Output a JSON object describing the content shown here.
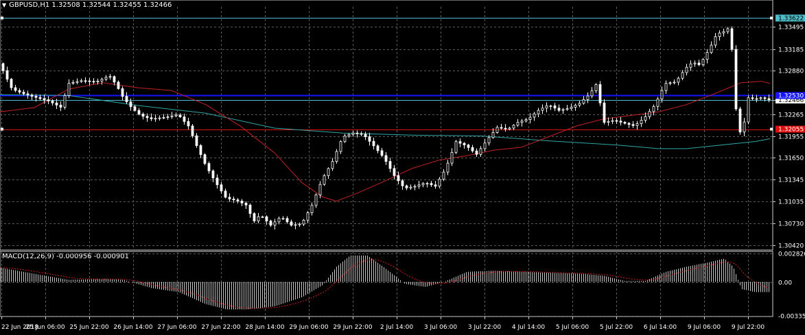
{
  "symbol_title": "GBPUSD,H1  1.32508 1.32544 1.32455 1.32466",
  "macd_title": "MACD(12,26,9) -0.000956 -0.000901",
  "colors": {
    "background": "#000000",
    "grid": "#5a5a5a",
    "candle": "#ffffff",
    "ma_slow": "#2fa7a7",
    "ma_fast": "#c42222",
    "level_high": "#4dbcc8",
    "level_blue": "#1414ff",
    "level_red": "#e01010",
    "macd_hist": "#c8c8c8",
    "macd_signal": "#d42020"
  },
  "price_axis": {
    "ticks": [
      "1.33495",
      "1.33185",
      "1.32880",
      "1.32466",
      "1.32265",
      "1.31955",
      "1.31650",
      "1.31345",
      "1.31035",
      "1.30730",
      "1.30420"
    ],
    "tick_values": [
      1.33495,
      1.33185,
      1.3288,
      1.32466,
      1.32265,
      1.31955,
      1.3165,
      1.31345,
      1.31035,
      1.3073,
      1.3042
    ],
    "range": [
      1.3035,
      1.3378
    ]
  },
  "price_labels": [
    {
      "text": "1.33622",
      "value": 1.33622,
      "bg": "#4dbcc8",
      "fg": "#000000"
    },
    {
      "text": "1.32466",
      "value": 1.32466,
      "bg": "#ffffff",
      "fg": "#000000"
    },
    {
      "text": "1.32055",
      "value": 1.32055,
      "bg": "#e01010",
      "fg": "#ffffff"
    },
    {
      "text": "1.32530",
      "value": 1.3253,
      "bg": "#1414ff",
      "fg": "#ffffff"
    }
  ],
  "levels": [
    {
      "name": "high-level",
      "value": 1.33622,
      "color": "#4dbcc8"
    },
    {
      "name": "blue-level",
      "value": 1.3253,
      "color": "#1414ff"
    },
    {
      "name": "current-level",
      "value": 1.32466,
      "color": "#4dbcc8"
    },
    {
      "name": "red-level",
      "value": 1.32055,
      "color": "#e01010"
    }
  ],
  "macd_axis": {
    "ticks": [
      "0.002826",
      "0.00",
      "-0.003355"
    ],
    "tick_values": [
      0.002826,
      0.0,
      -0.003355
    ]
  },
  "time_axis": [
    "22 Jun 2018",
    "25 Jun 06:00",
    "25 Jun 22:00",
    "26 Jun 14:00",
    "27 Jun 06:00",
    "27 Jun 22:00",
    "28 Jun 14:00",
    "29 Jun 06:00",
    "29 Jun 22:00",
    "2 Jul 14:00",
    "3 Jul 06:00",
    "3 Jul 22:00",
    "4 Jul 14:00",
    "5 Jul 06:00",
    "5 Jul 22:00",
    "6 Jul 14:00",
    "9 Jul 06:00",
    "9 Jul 22:00"
  ],
  "chart_data": {
    "type": "candlestick",
    "title": "GBPUSD,H1",
    "close_path": [
      [
        0,
        1.3298
      ],
      [
        18,
        1.3262
      ],
      [
        36,
        1.3255
      ],
      [
        54,
        1.325
      ],
      [
        72,
        1.3245
      ],
      [
        90,
        1.3236
      ],
      [
        100,
        1.327
      ],
      [
        120,
        1.3274
      ],
      [
        140,
        1.3272
      ],
      [
        160,
        1.3281
      ],
      [
        170,
        1.3268
      ],
      [
        180,
        1.325
      ],
      [
        190,
        1.3238
      ],
      [
        205,
        1.3225
      ],
      [
        220,
        1.322
      ],
      [
        240,
        1.3222
      ],
      [
        260,
        1.3226
      ],
      [
        275,
        1.321
      ],
      [
        288,
        1.318
      ],
      [
        300,
        1.3155
      ],
      [
        315,
        1.313
      ],
      [
        330,
        1.3108
      ],
      [
        345,
        1.3105
      ],
      [
        360,
        1.3098
      ],
      [
        370,
        1.3075
      ],
      [
        380,
        1.3085
      ],
      [
        395,
        1.307
      ],
      [
        410,
        1.3082
      ],
      [
        425,
        1.307
      ],
      [
        440,
        1.3072
      ],
      [
        455,
        1.3098
      ],
      [
        470,
        1.3135
      ],
      [
        485,
        1.316
      ],
      [
        500,
        1.3195
      ],
      [
        515,
        1.32
      ],
      [
        530,
        1.3198
      ],
      [
        545,
        1.3182
      ],
      [
        560,
        1.3165
      ],
      [
        575,
        1.314
      ],
      [
        590,
        1.3122
      ],
      [
        605,
        1.3125
      ],
      [
        620,
        1.313
      ],
      [
        635,
        1.3125
      ],
      [
        650,
        1.315
      ],
      [
        665,
        1.3188
      ],
      [
        680,
        1.3182
      ],
      [
        695,
        1.317
      ],
      [
        710,
        1.319
      ],
      [
        725,
        1.3208
      ],
      [
        740,
        1.3205
      ],
      [
        755,
        1.3215
      ],
      [
        770,
        1.322
      ],
      [
        785,
        1.3232
      ],
      [
        800,
        1.324
      ],
      [
        815,
        1.3232
      ],
      [
        830,
        1.3235
      ],
      [
        845,
        1.3242
      ],
      [
        860,
        1.3255
      ],
      [
        870,
        1.327
      ],
      [
        880,
        1.3215
      ],
      [
        895,
        1.3218
      ],
      [
        910,
        1.3214
      ],
      [
        925,
        1.321
      ],
      [
        940,
        1.3222
      ],
      [
        955,
        1.324
      ],
      [
        970,
        1.327
      ],
      [
        985,
        1.3272
      ],
      [
        1000,
        1.3292
      ],
      [
        1010,
        1.33
      ],
      [
        1020,
        1.3296
      ],
      [
        1035,
        1.332
      ],
      [
        1045,
        1.334
      ],
      [
        1055,
        1.3343
      ],
      [
        1065,
        1.335
      ],
      [
        1070,
        1.327
      ],
      [
        1075,
        1.321
      ],
      [
        1082,
        1.3195
      ],
      [
        1090,
        1.325
      ],
      [
        1100,
        1.3248
      ],
      [
        1110,
        1.325
      ],
      [
        1122,
        1.32466
      ]
    ],
    "ma_slow_path": [
      [
        0,
        1.3254
      ],
      [
        100,
        1.3253
      ],
      [
        200,
        1.3239
      ],
      [
        300,
        1.3228
      ],
      [
        400,
        1.3207
      ],
      [
        500,
        1.32
      ],
      [
        600,
        1.3197
      ],
      [
        700,
        1.3196
      ],
      [
        800,
        1.3189
      ],
      [
        900,
        1.3183
      ],
      [
        960,
        1.3178
      ],
      [
        1000,
        1.3178
      ],
      [
        1060,
        1.3184
      ],
      [
        1100,
        1.3188
      ],
      [
        1122,
        1.3192
      ]
    ],
    "ma_fast_path": [
      [
        0,
        1.323
      ],
      [
        50,
        1.3236
      ],
      [
        100,
        1.3262
      ],
      [
        150,
        1.3271
      ],
      [
        200,
        1.3264
      ],
      [
        250,
        1.326
      ],
      [
        300,
        1.324
      ],
      [
        350,
        1.321
      ],
      [
        400,
        1.3172
      ],
      [
        440,
        1.313
      ],
      [
        470,
        1.311
      ],
      [
        490,
        1.3104
      ],
      [
        520,
        1.3115
      ],
      [
        560,
        1.3132
      ],
      [
        600,
        1.315
      ],
      [
        640,
        1.3162
      ],
      [
        680,
        1.3168
      ],
      [
        720,
        1.3176
      ],
      [
        760,
        1.318
      ],
      [
        800,
        1.3195
      ],
      [
        840,
        1.321
      ],
      [
        880,
        1.322
      ],
      [
        920,
        1.3225
      ],
      [
        960,
        1.323
      ],
      [
        1000,
        1.324
      ],
      [
        1040,
        1.3255
      ],
      [
        1080,
        1.3271
      ],
      [
        1110,
        1.3273
      ],
      [
        1122,
        1.327
      ]
    ],
    "macd_hist_path": [
      [
        0,
        0.0014
      ],
      [
        50,
        0.0008
      ],
      [
        100,
        0.0002
      ],
      [
        150,
        0.0003
      ],
      [
        180,
        0.0002
      ],
      [
        220,
        -0.0006
      ],
      [
        260,
        -0.001
      ],
      [
        300,
        -0.0022
      ],
      [
        330,
        -0.0027
      ],
      [
        360,
        -0.0027
      ],
      [
        400,
        -0.0024
      ],
      [
        440,
        -0.0015
      ],
      [
        470,
        -0.0003
      ],
      [
        490,
        0.0015
      ],
      [
        510,
        0.0026
      ],
      [
        535,
        0.0026
      ],
      [
        560,
        0.0014
      ],
      [
        590,
        -0.0002
      ],
      [
        620,
        -0.0005
      ],
      [
        650,
        0.0001
      ],
      [
        680,
        0.001
      ],
      [
        720,
        0.0011
      ],
      [
        760,
        0.001
      ],
      [
        800,
        0.0009
      ],
      [
        850,
        0.0008
      ],
      [
        880,
        0.0006
      ],
      [
        910,
        0.0001
      ],
      [
        940,
        0.0001
      ],
      [
        970,
        0.001
      ],
      [
        1000,
        0.0015
      ],
      [
        1030,
        0.0019
      ],
      [
        1055,
        0.0023
      ],
      [
        1068,
        0.0015
      ],
      [
        1080,
        -0.0007
      ],
      [
        1100,
        -0.001
      ],
      [
        1122,
        -0.001
      ]
    ]
  }
}
